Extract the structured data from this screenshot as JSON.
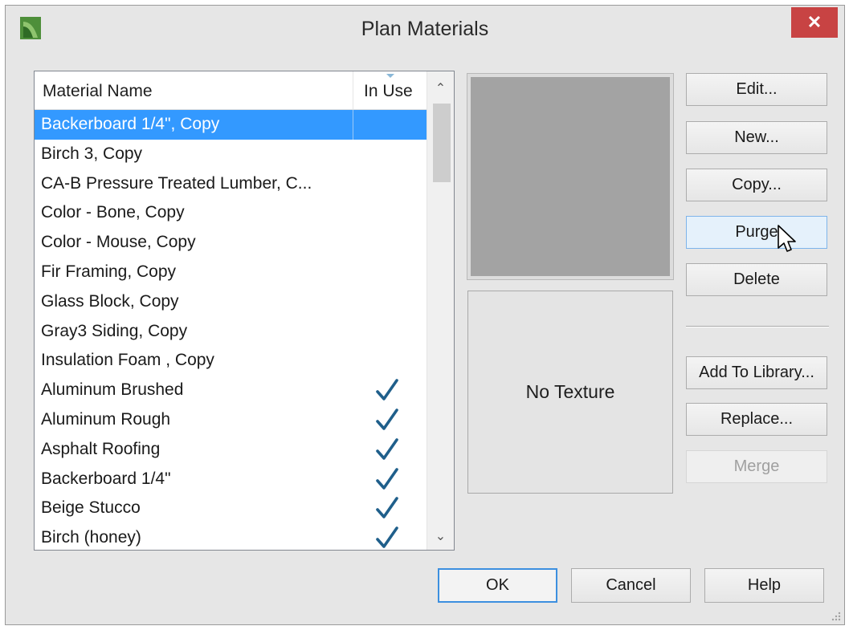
{
  "window": {
    "title": "Plan Materials",
    "close_label": "✕"
  },
  "list": {
    "col_name": "Material Name",
    "col_in_use": "In Use",
    "rows": [
      {
        "name": "Backerboard 1/4\", Copy",
        "in_use": false,
        "selected": true
      },
      {
        "name": "Birch 3, Copy",
        "in_use": false
      },
      {
        "name": "CA-B Pressure Treated Lumber, C...",
        "in_use": false
      },
      {
        "name": "Color - Bone, Copy",
        "in_use": false
      },
      {
        "name": "Color - Mouse, Copy",
        "in_use": false
      },
      {
        "name": "Fir Framing, Copy",
        "in_use": false
      },
      {
        "name": "Glass Block, Copy",
        "in_use": false
      },
      {
        "name": "Gray3 Siding, Copy",
        "in_use": false
      },
      {
        "name": "Insulation  Foam , Copy",
        "in_use": false
      },
      {
        "name": "Aluminum Brushed",
        "in_use": true
      },
      {
        "name": "Aluminum Rough",
        "in_use": true
      },
      {
        "name": "Asphalt Roofing",
        "in_use": true
      },
      {
        "name": "Backerboard 1/4\"",
        "in_use": true
      },
      {
        "name": "Beige Stucco",
        "in_use": true
      },
      {
        "name": "Birch (honey)",
        "in_use": true
      }
    ]
  },
  "preview": {
    "color": "#a3a3a3",
    "texture_label": "No Texture"
  },
  "buttons": {
    "edit": "Edit...",
    "new": "New...",
    "copy": "Copy...",
    "purge": "Purge",
    "delete": "Delete",
    "add_to_library": "Add To Library...",
    "replace": "Replace...",
    "merge": "Merge",
    "ok": "OK",
    "cancel": "Cancel",
    "help": "Help"
  },
  "colors": {
    "selection": "#3399ff",
    "check": "#1f5f8b",
    "close": "#c84343"
  }
}
